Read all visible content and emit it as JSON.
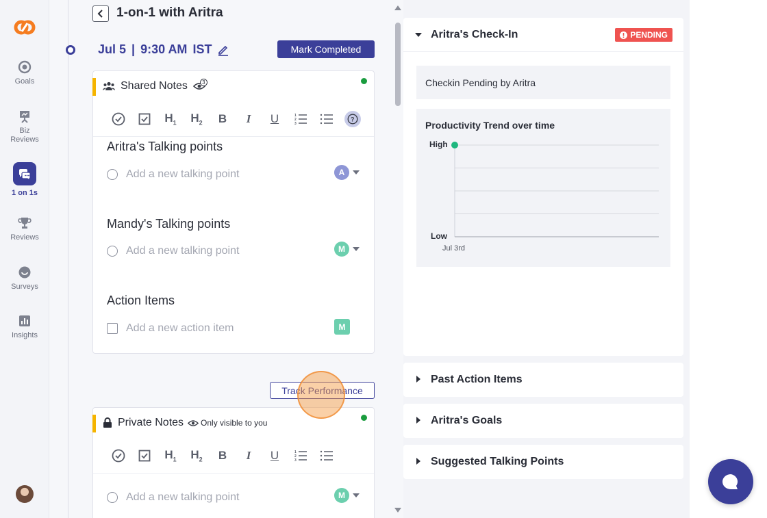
{
  "sidebar": {
    "items": [
      {
        "label": "Goals",
        "icon": "target-icon"
      },
      {
        "label": "Biz Reviews",
        "icon": "presentation-icon"
      },
      {
        "label": "1 on 1s",
        "icon": "chat-icon"
      },
      {
        "label": "Reviews",
        "icon": "trophy-icon"
      },
      {
        "label": "Surveys",
        "icon": "survey-icon"
      },
      {
        "label": "Insights",
        "icon": "bar-chart-icon"
      }
    ],
    "active": "1 on 1s"
  },
  "header": {
    "title": "1-on-1 with Aritra",
    "date": "Jul 5",
    "time": "9:30 AM",
    "timezone": "IST",
    "mark_completed": "Mark Completed"
  },
  "shared_notes": {
    "title": "Shared Notes",
    "viewer_count": "3",
    "sections": [
      {
        "title": "Aritra's Talking points",
        "placeholder": "Add a new talking point",
        "assignee": "A",
        "assignee_color": "#8e96d6"
      },
      {
        "title": "Mandy's Talking points",
        "placeholder": "Add a new talking point",
        "assignee": "M",
        "assignee_color": "#6ccfae"
      },
      {
        "title": "Action Items",
        "placeholder": "Add a new action item",
        "assignee": "M",
        "assignee_color": "#6ccfae"
      }
    ]
  },
  "track_performance": "Track Performance",
  "private_notes": {
    "title": "Private Notes",
    "visibility": "Only visible to you",
    "placeholder": "Add a new talking point",
    "assignee": "M"
  },
  "checkin": {
    "title": "Aritra's Check-In",
    "status": "PENDING",
    "message": "Checkin Pending by Aritra",
    "trend_title": "Productivity Trend over time",
    "y_high": "High",
    "y_low": "Low",
    "x_label": "Jul 3rd"
  },
  "chart_data": {
    "type": "line",
    "title": "Productivity Trend over time",
    "categories": [
      "Jul 3rd"
    ],
    "y_scale": [
      "Low",
      "High"
    ],
    "values": [
      "High"
    ]
  },
  "accordions": [
    {
      "title": "Past Action Items"
    },
    {
      "title": "Aritra's Goals"
    },
    {
      "title": "Suggested Talking Points"
    }
  ],
  "colors": {
    "brand": "#3b3f99",
    "pending": "#ef5350",
    "accent_yellow": "#f5b400",
    "online": "#1a9c3e",
    "trend_point": "#1fb77f"
  }
}
